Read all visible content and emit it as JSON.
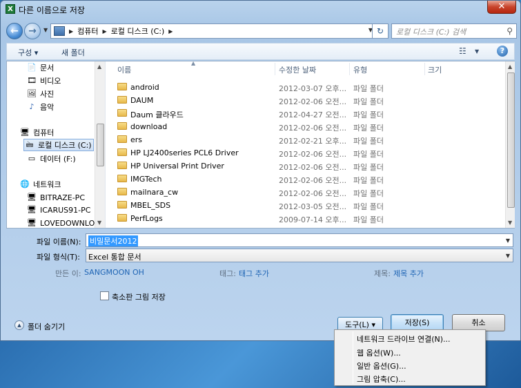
{
  "window": {
    "title": "다른 이름으로 저장",
    "app_icon": "X",
    "close_label": "✕"
  },
  "address": {
    "crumbs": [
      "컴퓨터",
      "로컬 디스크 (C:)"
    ],
    "search_placeholder": "로컬 디스크 (C:) 검색"
  },
  "toolbar": {
    "organize": "구성 ▾",
    "new_folder": "새 폴더"
  },
  "nav": {
    "items": [
      {
        "label": "문서",
        "icon": "documents-icon"
      },
      {
        "label": "비디오",
        "icon": "video-icon"
      },
      {
        "label": "사진",
        "icon": "pictures-icon"
      },
      {
        "label": "음악",
        "icon": "music-icon"
      },
      {
        "label": "컴퓨터",
        "icon": "computer-icon"
      },
      {
        "label": "로컬 디스크 (C:)",
        "icon": "drive-icon"
      },
      {
        "label": "데이터 (F:)",
        "icon": "drive-icon"
      },
      {
        "label": "네트워크",
        "icon": "network-icon"
      },
      {
        "label": "BITRAZE-PC",
        "icon": "pc-icon"
      },
      {
        "label": "ICARUS91-PC",
        "icon": "pc-icon"
      },
      {
        "label": "LOVEDOWNLOA",
        "icon": "pc-icon"
      }
    ]
  },
  "columns": {
    "name": "이름",
    "modified": "수정한 날짜",
    "type": "유형",
    "size": "크기"
  },
  "files": [
    {
      "name": "android",
      "date": "2012-03-07 오후...",
      "type": "파일 폴더"
    },
    {
      "name": "DAUM",
      "date": "2012-02-06 오전...",
      "type": "파일 폴더"
    },
    {
      "name": "Daum 클라우드",
      "date": "2012-04-27 오전...",
      "type": "파일 폴더"
    },
    {
      "name": "download",
      "date": "2012-02-06 오전...",
      "type": "파일 폴더"
    },
    {
      "name": "ers",
      "date": "2012-02-21 오후...",
      "type": "파일 폴더"
    },
    {
      "name": "HP LJ2400series PCL6 Driver",
      "date": "2012-02-06 오전...",
      "type": "파일 폴더"
    },
    {
      "name": "HP Universal Print Driver",
      "date": "2012-02-06 오전...",
      "type": "파일 폴더"
    },
    {
      "name": "IMGTech",
      "date": "2012-02-06 오전...",
      "type": "파일 폴더"
    },
    {
      "name": "mailnara_cw",
      "date": "2012-02-06 오전...",
      "type": "파일 폴더"
    },
    {
      "name": "MBEL_SDS",
      "date": "2012-03-05 오전...",
      "type": "파일 폴더"
    },
    {
      "name": "PerfLogs",
      "date": "2009-07-14 오후...",
      "type": "파일 폴더"
    }
  ],
  "form": {
    "filename_label": "파일 이름(N):",
    "filename_value": "비밀문서2012",
    "filetype_label": "파일 형식(T):",
    "filetype_value": "Excel 통합 문서",
    "author_label": "만든 이:",
    "author_value": "SANGMOON OH",
    "tags_label": "태그:",
    "tags_value": "태그 추가",
    "title_label": "제목:",
    "title_value": "제목 추가",
    "thumbnail_label": "축소판 그림 저장",
    "hide_folders": "폴더 숨기기"
  },
  "buttons": {
    "tools": "도구(L)  ▾",
    "save": "저장(S)",
    "cancel": "취소"
  },
  "tools_menu": [
    "네트워크 드라이브 연결(N)...",
    "웹 옵션(W)...",
    "일반 옵션(G)...",
    "그림 압축(C)..."
  ]
}
